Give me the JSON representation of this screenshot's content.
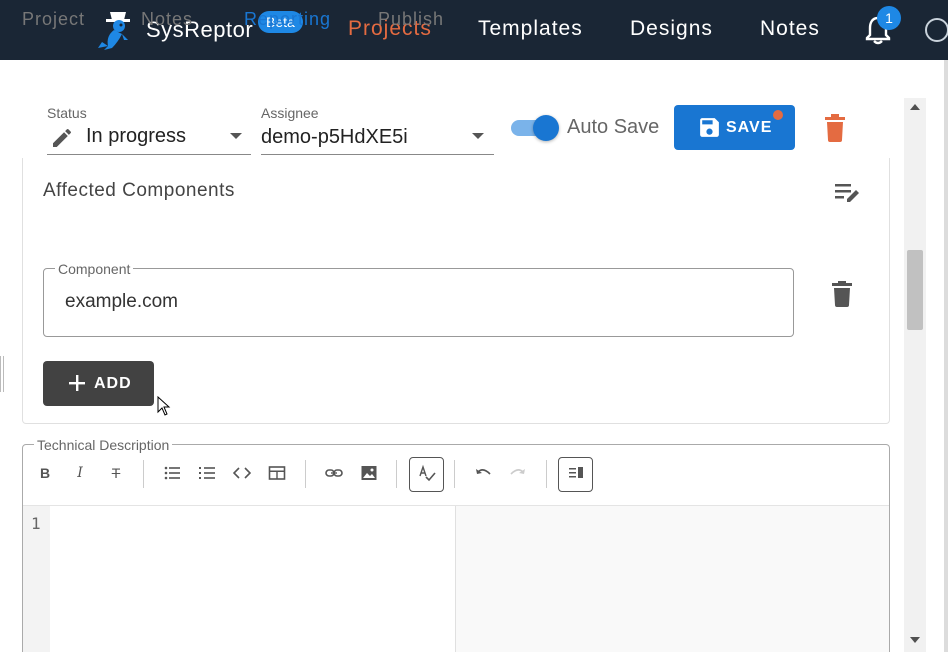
{
  "app": {
    "brand": "SysReptor",
    "beta_badge": "Beta",
    "nav": [
      {
        "label": "Projects",
        "active": true
      },
      {
        "label": "Templates",
        "active": false
      },
      {
        "label": "Designs",
        "active": false
      },
      {
        "label": "Notes",
        "active": false
      }
    ],
    "notification_count": "1"
  },
  "subtabs": [
    {
      "label": "Project",
      "active": false
    },
    {
      "label": "Notes",
      "active": false
    },
    {
      "label": "Reporting",
      "active": true
    },
    {
      "label": "Publish",
      "active": false
    }
  ],
  "toolbar": {
    "status_label": "Status",
    "status_value": "In progress",
    "assignee_label": "Assignee",
    "assignee_value": "demo-p5HdXE5i",
    "autosave_label": "Auto Save",
    "autosave_on": true,
    "save_label": "SAVE",
    "unsaved_changes": true
  },
  "affected_components": {
    "title": "Affected Components",
    "field_label": "Component",
    "items": [
      "example.com"
    ],
    "add_label": "ADD"
  },
  "technical_description": {
    "label": "Technical Description",
    "line_numbers": [
      "1"
    ],
    "toolbar_icons": [
      "bold-icon",
      "italic-icon",
      "strikethrough-icon",
      "bullet-list-icon",
      "numbered-list-icon",
      "code-icon",
      "table-icon",
      "link-icon",
      "image-icon",
      "spellcheck-icon",
      "undo-icon",
      "redo-icon",
      "preview-icon"
    ]
  },
  "colors": {
    "topbar": "#1a2635",
    "accent_orange": "#e46b41",
    "primary_blue": "#1976d2",
    "add_button": "#424242"
  }
}
